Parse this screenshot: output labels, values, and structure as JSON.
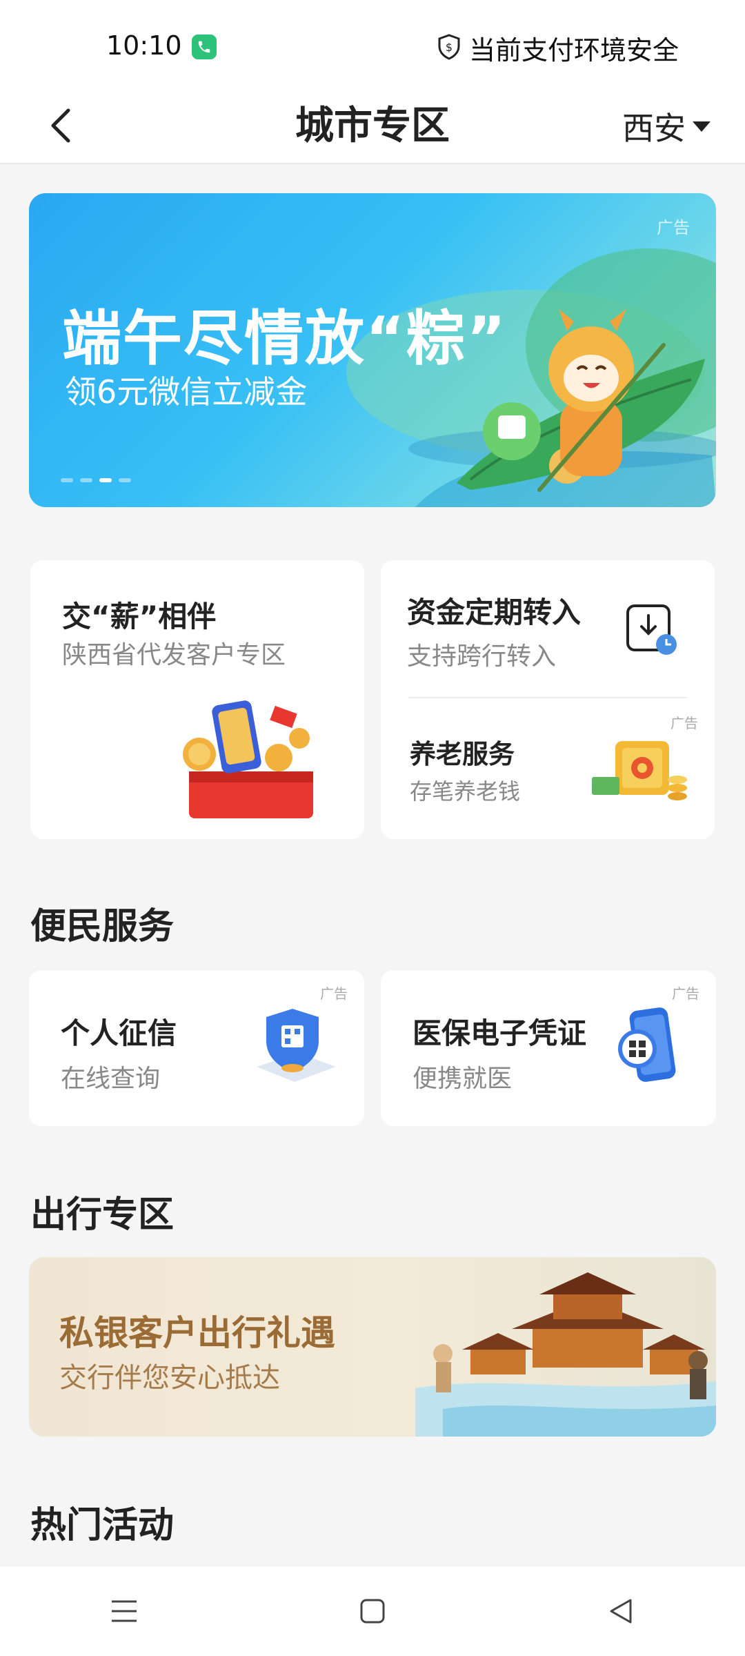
{
  "status_bar": {
    "time": "10:10",
    "security_text": "当前支付环境安全",
    "icons": [
      "phone-call-icon",
      "shield-icon"
    ]
  },
  "nav": {
    "title": "城市专区",
    "city": "西安",
    "icons": [
      "back-icon",
      "caret-down-icon"
    ]
  },
  "banner": {
    "title": "端午尽情放“粽”",
    "subtitle": "领6元微信立减金",
    "ad_label": "广告",
    "page_count": 4,
    "active_page": 3
  },
  "feature_cards": {
    "salary": {
      "title": "交“薪”相伴",
      "subtitle": "陕西省代发客户专区"
    },
    "transfer": {
      "title": "资金定期转入",
      "subtitle": "支持跨行转入",
      "icon": "scheduled-transfer-icon"
    },
    "pension": {
      "title": "养老服务",
      "subtitle": "存笔养老钱",
      "ad_label": "广告",
      "icon": "safe-box-icon"
    }
  },
  "convenience": {
    "section_title": "便民服务",
    "items": [
      {
        "title": "个人征信",
        "subtitle": "在线查询",
        "ad_label": "广告",
        "icon": "credit-shield-icon"
      },
      {
        "title": "医保电子凭证",
        "subtitle": "便携就医",
        "ad_label": "广告",
        "icon": "medical-card-phone-icon"
      }
    ]
  },
  "travel": {
    "section_title": "出行专区",
    "banner_title": "私银客户出行礼遇",
    "banner_subtitle": "交行伴您安心抵达"
  },
  "hot": {
    "section_title": "热门活动"
  },
  "system_nav": {
    "icons": [
      "menu-icon",
      "home-square-icon",
      "back-triangle-icon"
    ]
  },
  "colors": {
    "accent_green": "#2dc27a",
    "banner_blue": "#29a8f2",
    "travel_gold": "#9a6b34",
    "background": "#f5f5f5"
  }
}
